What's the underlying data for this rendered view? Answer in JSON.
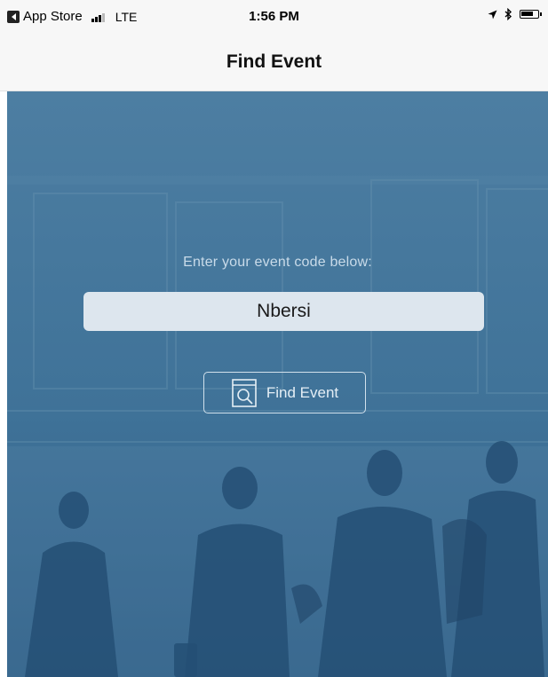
{
  "status_bar": {
    "back_app": "App Store",
    "carrier": "LTE",
    "time": "1:56 PM",
    "signal_bars": 4,
    "signal_bars_active": 3
  },
  "nav": {
    "title": "Find Event"
  },
  "main": {
    "prompt": "Enter your event code below:",
    "event_code_value": "Nbersi",
    "find_button_label": "Find Event"
  },
  "colors": {
    "overlay_blue": "#3f7298",
    "button_border": "#d2e1ec",
    "input_background": "#dde6ee",
    "nav_background": "#f7f7f7"
  },
  "icons": {
    "back": "back-arrow-icon",
    "signal": "cellular-signal-icon",
    "location": "location-arrow-icon",
    "bluetooth": "bluetooth-icon",
    "battery": "battery-icon",
    "find": "magnifier-search-icon"
  }
}
